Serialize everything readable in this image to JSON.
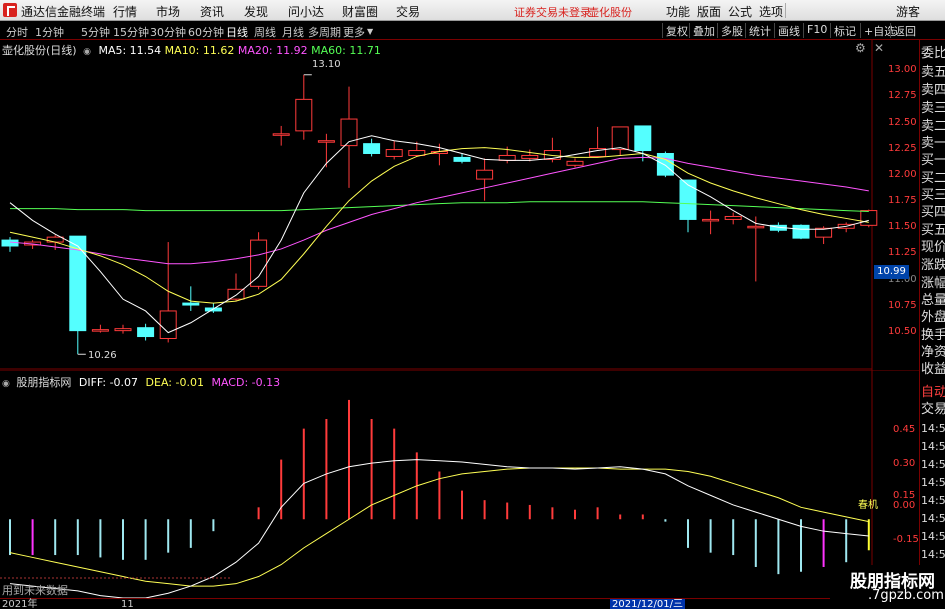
{
  "topbar": {
    "app_title": "通达信金融终端",
    "menus": [
      "行情",
      "市场",
      "资讯",
      "发现",
      "问小达",
      "财富圈",
      "交易"
    ],
    "notice": "证券交易未登录",
    "stock": "壶化股份",
    "right_menus": [
      "功能",
      "版面",
      "公式",
      "选项"
    ],
    "user": "游客"
  },
  "periodbar": {
    "periods": [
      "分时",
      "1分钟",
      "5分钟",
      "15分钟",
      "30分钟",
      "60分钟",
      "日线",
      "周线",
      "月线",
      "多周期",
      "更多"
    ],
    "active": "日线",
    "tools": [
      "复权",
      "叠加",
      "多股",
      "统计",
      "画线",
      "F10",
      "标记",
      "+自选",
      "返回"
    ]
  },
  "main_header": {
    "title": "壶化股份(日线)",
    "ma5": "MA5: 11.54",
    "ma10": "MA10: 11.62",
    "ma20": "MA20: 11.92",
    "ma60": "MA60: 11.71"
  },
  "annotations": {
    "high": "13.10",
    "low": "10.26"
  },
  "current_price": "10.99",
  "price_axis": [
    "13.00",
    "12.75",
    "12.50",
    "12.25",
    "12.00",
    "11.75",
    "11.50",
    "11.25",
    "11.00",
    "10.75",
    "10.50"
  ],
  "macd_header": {
    "title": "股朋指标网",
    "diff": "DIFF: -0.07",
    "dea": "DEA: -0.01",
    "macd": "MACD: -0.13"
  },
  "macd_axis": [
    "0.45",
    "0.30",
    "0.15",
    "0.00",
    "-0.15"
  ],
  "macd_note": "用到未来数据",
  "macd_side_tag": "春机",
  "sidebar": {
    "orderbook": [
      "委比",
      "卖五",
      "卖四",
      "卖三",
      "卖二",
      "卖一",
      "买一",
      "买二",
      "买三",
      "买四",
      "买五"
    ],
    "stats": [
      "现价",
      "涨跌",
      "涨幅",
      "总量",
      "外盘",
      "换手",
      "净资",
      "收益"
    ],
    "tabs": [
      "自动",
      "交易"
    ],
    "times": [
      "14:55",
      "14:55",
      "14:56",
      "14:56",
      "14:56",
      "14:56",
      "14:56",
      "14:56",
      "14:56",
      "14:56"
    ]
  },
  "datebar": {
    "year": "2021年",
    "month": "11",
    "cursor": "2021/12/01/三"
  },
  "watermark": {
    "line1": "股朋指标网",
    "line2": ".7gpzb.com"
  },
  "colors": {
    "up": "#ff3b3b",
    "down": "#54ffff",
    "ma5": "#ffffff",
    "ma10": "#ffff55",
    "ma20": "#ff55ff",
    "ma60": "#55ff55",
    "grid": "#7a0000"
  },
  "chart_data": {
    "type": "candlestick",
    "price_range": [
      10.1,
      13.25
    ],
    "candles": [
      {
        "o": 11.42,
        "c": 11.36,
        "h": 11.45,
        "l": 11.3
      },
      {
        "o": 11.37,
        "c": 11.4,
        "h": 11.42,
        "l": 11.33
      },
      {
        "o": 11.4,
        "c": 11.45,
        "h": 11.47,
        "l": 11.32
      },
      {
        "o": 11.46,
        "c": 10.5,
        "h": 11.46,
        "l": 10.26
      },
      {
        "o": 10.5,
        "c": 10.51,
        "h": 10.56,
        "l": 10.48
      },
      {
        "o": 10.5,
        "c": 10.52,
        "h": 10.56,
        "l": 10.47
      },
      {
        "o": 10.53,
        "c": 10.44,
        "h": 10.57,
        "l": 10.4
      },
      {
        "o": 10.42,
        "c": 10.7,
        "h": 11.4,
        "l": 10.38
      },
      {
        "o": 10.78,
        "c": 10.76,
        "h": 10.95,
        "l": 10.7
      },
      {
        "o": 10.73,
        "c": 10.7,
        "h": 10.78,
        "l": 10.68
      },
      {
        "o": 10.82,
        "c": 10.92,
        "h": 11.08,
        "l": 10.8
      },
      {
        "o": 10.95,
        "c": 11.42,
        "h": 11.5,
        "l": 10.92
      },
      {
        "o": 12.5,
        "c": 12.5,
        "h": 12.58,
        "l": 12.38
      },
      {
        "o": 12.53,
        "c": 12.85,
        "h": 13.1,
        "l": 12.44
      },
      {
        "o": 12.43,
        "c": 12.43,
        "h": 12.5,
        "l": 12.16
      },
      {
        "o": 12.38,
        "c": 12.65,
        "h": 12.98,
        "l": 11.95
      },
      {
        "o": 12.4,
        "c": 12.3,
        "h": 12.45,
        "l": 12.27
      },
      {
        "o": 12.27,
        "c": 12.34,
        "h": 12.43,
        "l": 12.24
      },
      {
        "o": 12.28,
        "c": 12.33,
        "h": 12.42,
        "l": 12.27
      },
      {
        "o": 12.3,
        "c": 12.32,
        "h": 12.4,
        "l": 12.18
      },
      {
        "o": 12.26,
        "c": 12.22,
        "h": 12.3,
        "l": 12.2
      },
      {
        "o": 12.04,
        "c": 12.13,
        "h": 12.25,
        "l": 11.82
      },
      {
        "o": 12.23,
        "c": 12.28,
        "h": 12.37,
        "l": 12.2
      },
      {
        "o": 12.25,
        "c": 12.28,
        "h": 12.34,
        "l": 12.22
      },
      {
        "o": 12.24,
        "c": 12.33,
        "h": 12.46,
        "l": 12.21
      },
      {
        "o": 12.18,
        "c": 12.22,
        "h": 12.25,
        "l": 12.16
      },
      {
        "o": 12.27,
        "c": 12.35,
        "h": 12.57,
        "l": 12.26
      },
      {
        "o": 12.34,
        "c": 12.57,
        "h": 12.57,
        "l": 12.28
      },
      {
        "o": 12.58,
        "c": 12.33,
        "h": 12.58,
        "l": 12.22
      },
      {
        "o": 12.3,
        "c": 12.08,
        "h": 12.32,
        "l": 12.06
      },
      {
        "o": 12.03,
        "c": 11.63,
        "h": 12.03,
        "l": 11.5
      },
      {
        "o": 11.63,
        "c": 11.63,
        "h": 11.72,
        "l": 11.48
      },
      {
        "o": 11.63,
        "c": 11.66,
        "h": 11.7,
        "l": 11.58
      },
      {
        "o": 11.56,
        "c": 11.56,
        "h": 11.66,
        "l": 11.0
      },
      {
        "o": 11.57,
        "c": 11.52,
        "h": 11.6,
        "l": 11.5
      },
      {
        "o": 11.57,
        "c": 11.44,
        "h": 11.58,
        "l": 11.43
      },
      {
        "o": 11.45,
        "c": 11.54,
        "h": 11.56,
        "l": 11.38
      },
      {
        "o": 11.54,
        "c": 11.58,
        "h": 11.6,
        "l": 11.5
      },
      {
        "o": 11.57,
        "c": 11.72,
        "h": 11.73,
        "l": 11.55
      }
    ],
    "ma5": [
      11.8,
      11.62,
      11.48,
      11.36,
      11.1,
      10.82,
      10.7,
      10.48,
      10.58,
      10.72,
      10.86,
      11.05,
      11.42,
      11.9,
      12.2,
      12.42,
      12.48,
      12.43,
      12.4,
      12.36,
      12.3,
      12.24,
      12.23,
      12.23,
      12.25,
      12.29,
      12.33,
      12.36,
      12.3,
      12.18,
      11.98,
      11.86,
      11.72,
      11.59,
      11.55,
      11.53,
      11.53,
      11.56,
      11.62
    ],
    "ma10": [
      11.5,
      11.45,
      11.4,
      11.33,
      11.26,
      11.17,
      11.05,
      10.9,
      10.8,
      10.78,
      10.8,
      10.87,
      11.02,
      11.28,
      11.56,
      11.82,
      12.02,
      12.17,
      12.27,
      12.32,
      12.35,
      12.36,
      12.34,
      12.31,
      12.28,
      12.26,
      12.26,
      12.28,
      12.3,
      12.24,
      12.1,
      12.0,
      11.92,
      11.85,
      11.79,
      11.73,
      11.68,
      11.64,
      11.6
    ],
    "ma20": [
      11.4,
      11.38,
      11.35,
      11.32,
      11.28,
      11.24,
      11.21,
      11.18,
      11.18,
      11.2,
      11.23,
      11.27,
      11.33,
      11.42,
      11.52,
      11.6,
      11.68,
      11.74,
      11.8,
      11.85,
      11.9,
      11.95,
      12.0,
      12.05,
      12.1,
      12.15,
      12.2,
      12.25,
      12.26,
      12.25,
      12.2,
      12.16,
      12.12,
      12.08,
      12.05,
      12.02,
      11.99,
      11.96,
      11.92
    ],
    "ma60": [
      11.74,
      11.74,
      11.74,
      11.73,
      11.73,
      11.73,
      11.72,
      11.72,
      11.72,
      11.72,
      11.72,
      11.72,
      11.72,
      11.73,
      11.74,
      11.75,
      11.76,
      11.77,
      11.78,
      11.79,
      11.8,
      11.8,
      11.8,
      11.81,
      11.81,
      11.81,
      11.81,
      11.81,
      11.81,
      11.8,
      11.79,
      11.78,
      11.77,
      11.76,
      11.75,
      11.74,
      11.73,
      11.72,
      11.71
    ],
    "macd_range": [
      -0.33,
      0.55
    ],
    "macd_bars": [
      -0.15,
      -0.15,
      -0.15,
      -0.15,
      -0.16,
      -0.17,
      -0.17,
      -0.14,
      -0.12,
      -0.05,
      0.0,
      0.05,
      0.25,
      0.38,
      0.42,
      0.5,
      0.42,
      0.38,
      0.28,
      0.2,
      0.12,
      0.08,
      0.07,
      0.06,
      0.05,
      0.04,
      0.05,
      0.02,
      0.02,
      -0.01,
      -0.12,
      -0.14,
      -0.15,
      -0.2,
      -0.23,
      -0.22,
      -0.2,
      -0.18,
      -0.13
    ],
    "macd_diff": [
      -0.27,
      -0.28,
      -0.29,
      -0.3,
      -0.32,
      -0.33,
      -0.33,
      -0.31,
      -0.28,
      -0.24,
      -0.18,
      -0.1,
      0.05,
      0.15,
      0.19,
      0.22,
      0.235,
      0.245,
      0.25,
      0.245,
      0.24,
      0.23,
      0.22,
      0.215,
      0.215,
      0.21,
      0.215,
      0.22,
      0.21,
      0.19,
      0.14,
      0.1,
      0.06,
      0.03,
      0.0,
      -0.03,
      -0.05,
      -0.06,
      -0.07
    ],
    "macd_dea": [
      -0.14,
      -0.16,
      -0.18,
      -0.2,
      -0.22,
      -0.24,
      -0.26,
      -0.27,
      -0.28,
      -0.28,
      -0.27,
      -0.24,
      -0.19,
      -0.12,
      -0.06,
      0.0,
      0.06,
      0.1,
      0.14,
      0.17,
      0.19,
      0.2,
      0.21,
      0.215,
      0.215,
      0.215,
      0.215,
      0.21,
      0.21,
      0.21,
      0.2,
      0.18,
      0.15,
      0.12,
      0.09,
      0.05,
      0.03,
      0.01,
      -0.01
    ]
  }
}
